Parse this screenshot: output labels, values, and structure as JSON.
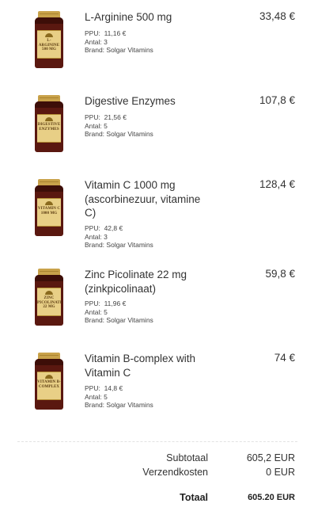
{
  "items": [
    {
      "title": "L-Arginine 500 mg",
      "price": "33,48 €",
      "ppu_label": "PPU:",
      "ppu": "11,16 €",
      "qty_label": "Antal:",
      "qty": "3",
      "brand_label": "Brand:",
      "brand": "Solgar Vitamins",
      "bottle_label": "L-ARGININE 500 MG"
    },
    {
      "title": "Digestive Enzymes",
      "price": "107,8 €",
      "ppu_label": "PPU:",
      "ppu": "21,56 €",
      "qty_label": "Antal:",
      "qty": "5",
      "brand_label": "Brand:",
      "brand": "Solgar Vitamins",
      "bottle_label": "DIGESTIVE ENZYMES"
    },
    {
      "title": "Vitamin C 1000 mg (ascorbinezuur, vitamine C)",
      "price": "128,4 €",
      "ppu_label": "PPU:",
      "ppu": "42,8 €",
      "qty_label": "Antal:",
      "qty": "3",
      "brand_label": "Brand:",
      "brand": "Solgar Vitamins",
      "bottle_label": "VITAMIN C 1000 MG"
    },
    {
      "title": "Zinc Picolinate 22 mg (zinkpicolinaat)",
      "price": "59,8 €",
      "ppu_label": "PPU:",
      "ppu": "11,96 €",
      "qty_label": "Antal:",
      "qty": "5",
      "brand_label": "Brand:",
      "brand": "Solgar Vitamins",
      "bottle_label": "ZINC PICOLINATE 22 MG"
    },
    {
      "title": "Vitamin B-complex with Vitamin C",
      "price": "74 €",
      "ppu_label": "PPU:",
      "ppu": "14,8 €",
      "qty_label": "Antal:",
      "qty": "5",
      "brand_label": "Brand:",
      "brand": "Solgar Vitamins",
      "bottle_label": "VITAMIN B-COMPLEX"
    }
  ],
  "summary": {
    "subtotal_label": "Subtotaal",
    "subtotal_value": "605,2 EUR",
    "shipping_label": "Verzendkosten",
    "shipping_value": "0 EUR",
    "total_label": "Totaal",
    "total_value": "605.20 EUR"
  },
  "colors": {
    "bottle": "#5a1810",
    "cap": "#c9a24a",
    "label": "#e8cf86"
  }
}
